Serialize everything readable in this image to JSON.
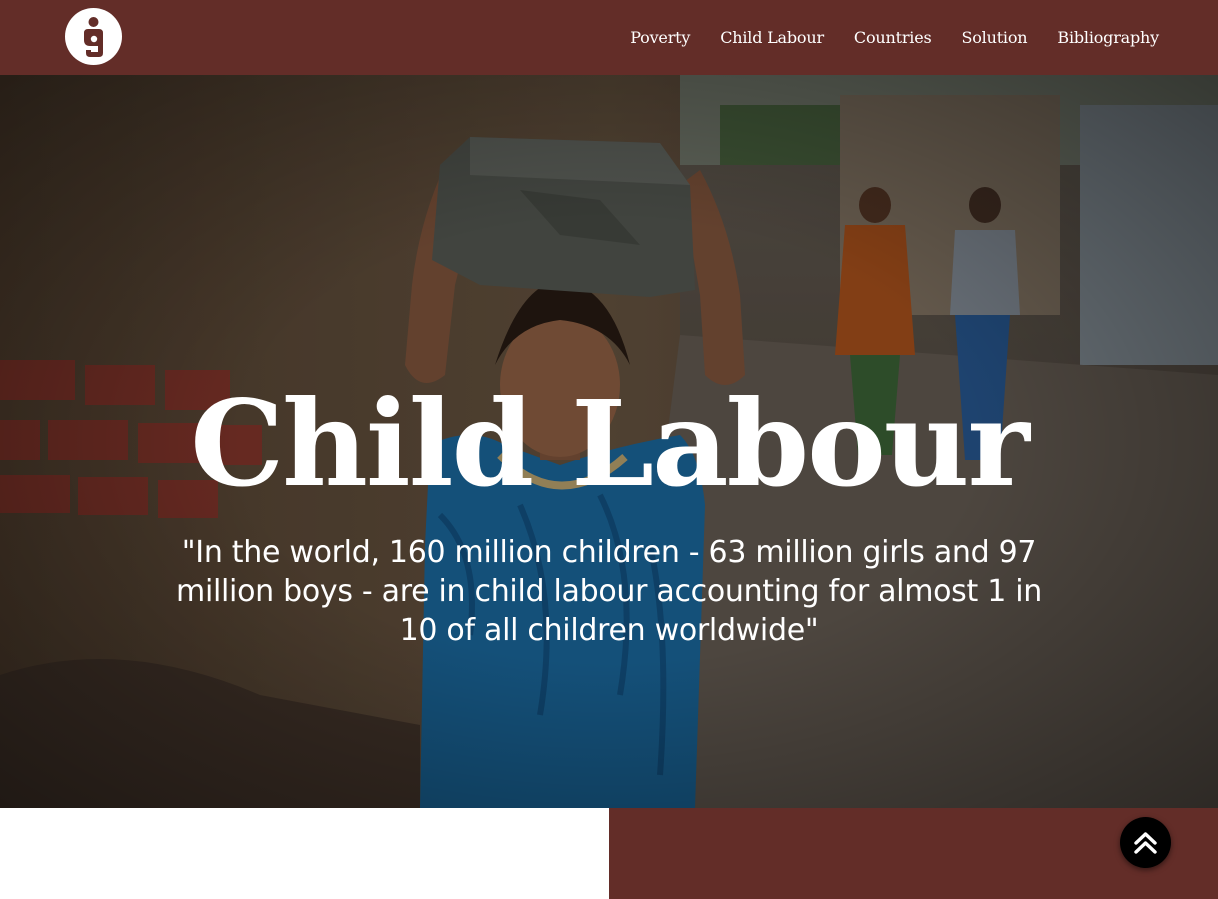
{
  "colors": {
    "brand": "#632d28",
    "text_on_brand": "#ffffff",
    "top_button": "#000000"
  },
  "header": {
    "logo_icon": "mother-child-icon",
    "nav": [
      {
        "label": "Poverty"
      },
      {
        "label": "Child Labour"
      },
      {
        "label": "Countries"
      },
      {
        "label": "Solution"
      },
      {
        "label": "Bibliography"
      }
    ]
  },
  "hero": {
    "title": "Child Labour",
    "quote": "\"In the world, 160 million children - 63 million girls and 97 million boys - are in child labour accounting for almost 1 in 10 of all children worldwide\"",
    "background_icon": "child-carrying-stone-photo"
  },
  "scroll_top": {
    "icon": "double-chevron-up-icon"
  }
}
